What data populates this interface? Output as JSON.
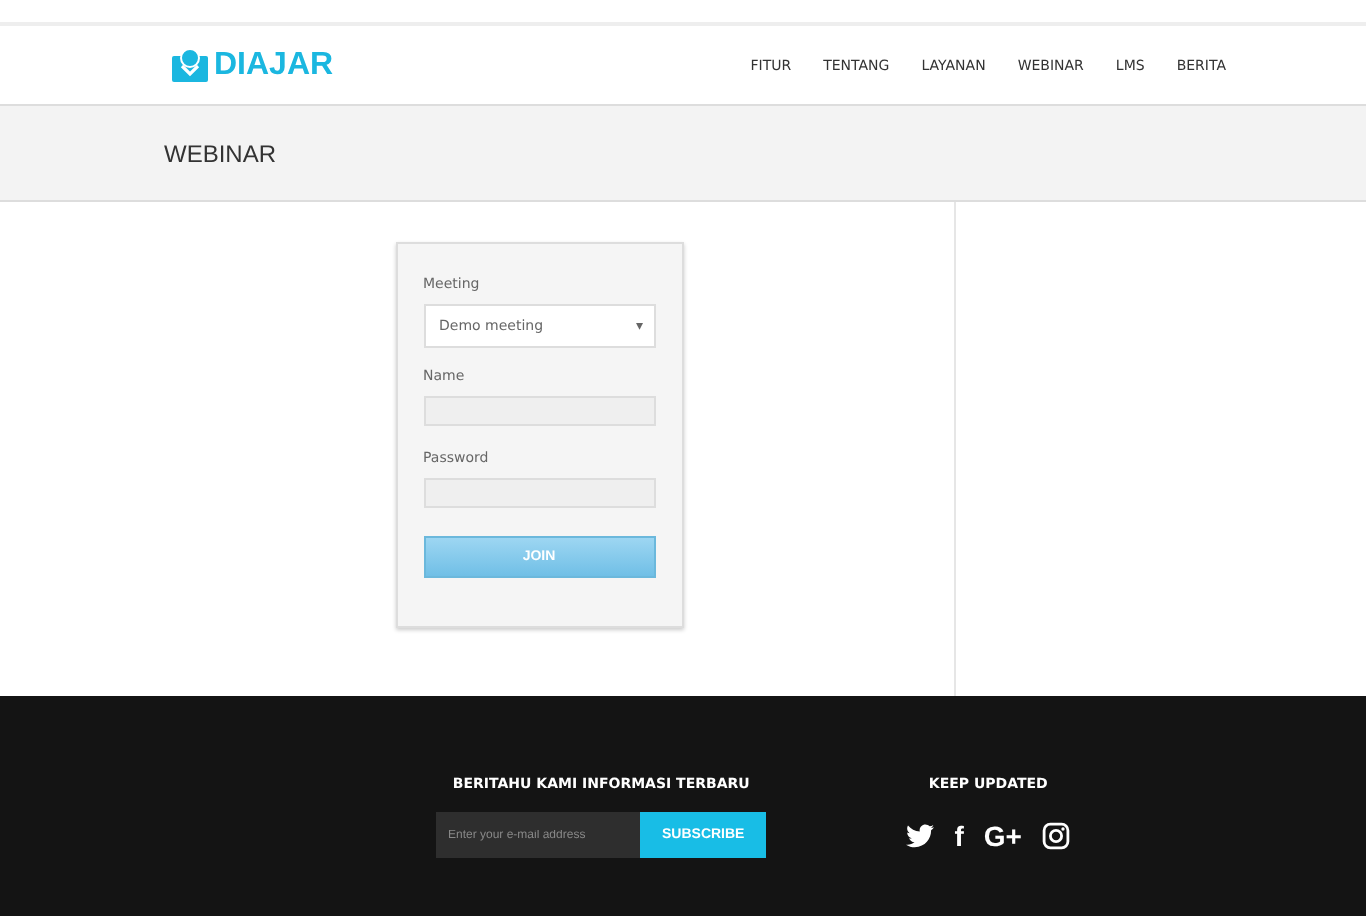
{
  "brand": {
    "name": "DIAJAR"
  },
  "nav": [
    {
      "label": "FITUR"
    },
    {
      "label": "TENTANG"
    },
    {
      "label": "LAYANAN"
    },
    {
      "label": "WEBINAR"
    },
    {
      "label": "LMS"
    },
    {
      "label": "BERITA"
    }
  ],
  "page_title": "WEBINAR",
  "form": {
    "meeting_label": "Meeting",
    "meeting_value": "Demo meeting",
    "caret": "▾",
    "name_label": "Name",
    "password_label": "Password",
    "join_button": "JOIN"
  },
  "footer": {
    "newsletter_title": "BERITAHU KAMI INFORMASI TERBARU",
    "email_placeholder": "Enter your e-mail address",
    "subscribe_button": "SUBSCRIBE",
    "social_title": "KEEP UPDATED",
    "social": [
      {
        "kind": "twitter"
      },
      {
        "kind": "text",
        "text": "f"
      },
      {
        "kind": "text",
        "text": "G+"
      },
      {
        "kind": "instagram"
      }
    ]
  }
}
